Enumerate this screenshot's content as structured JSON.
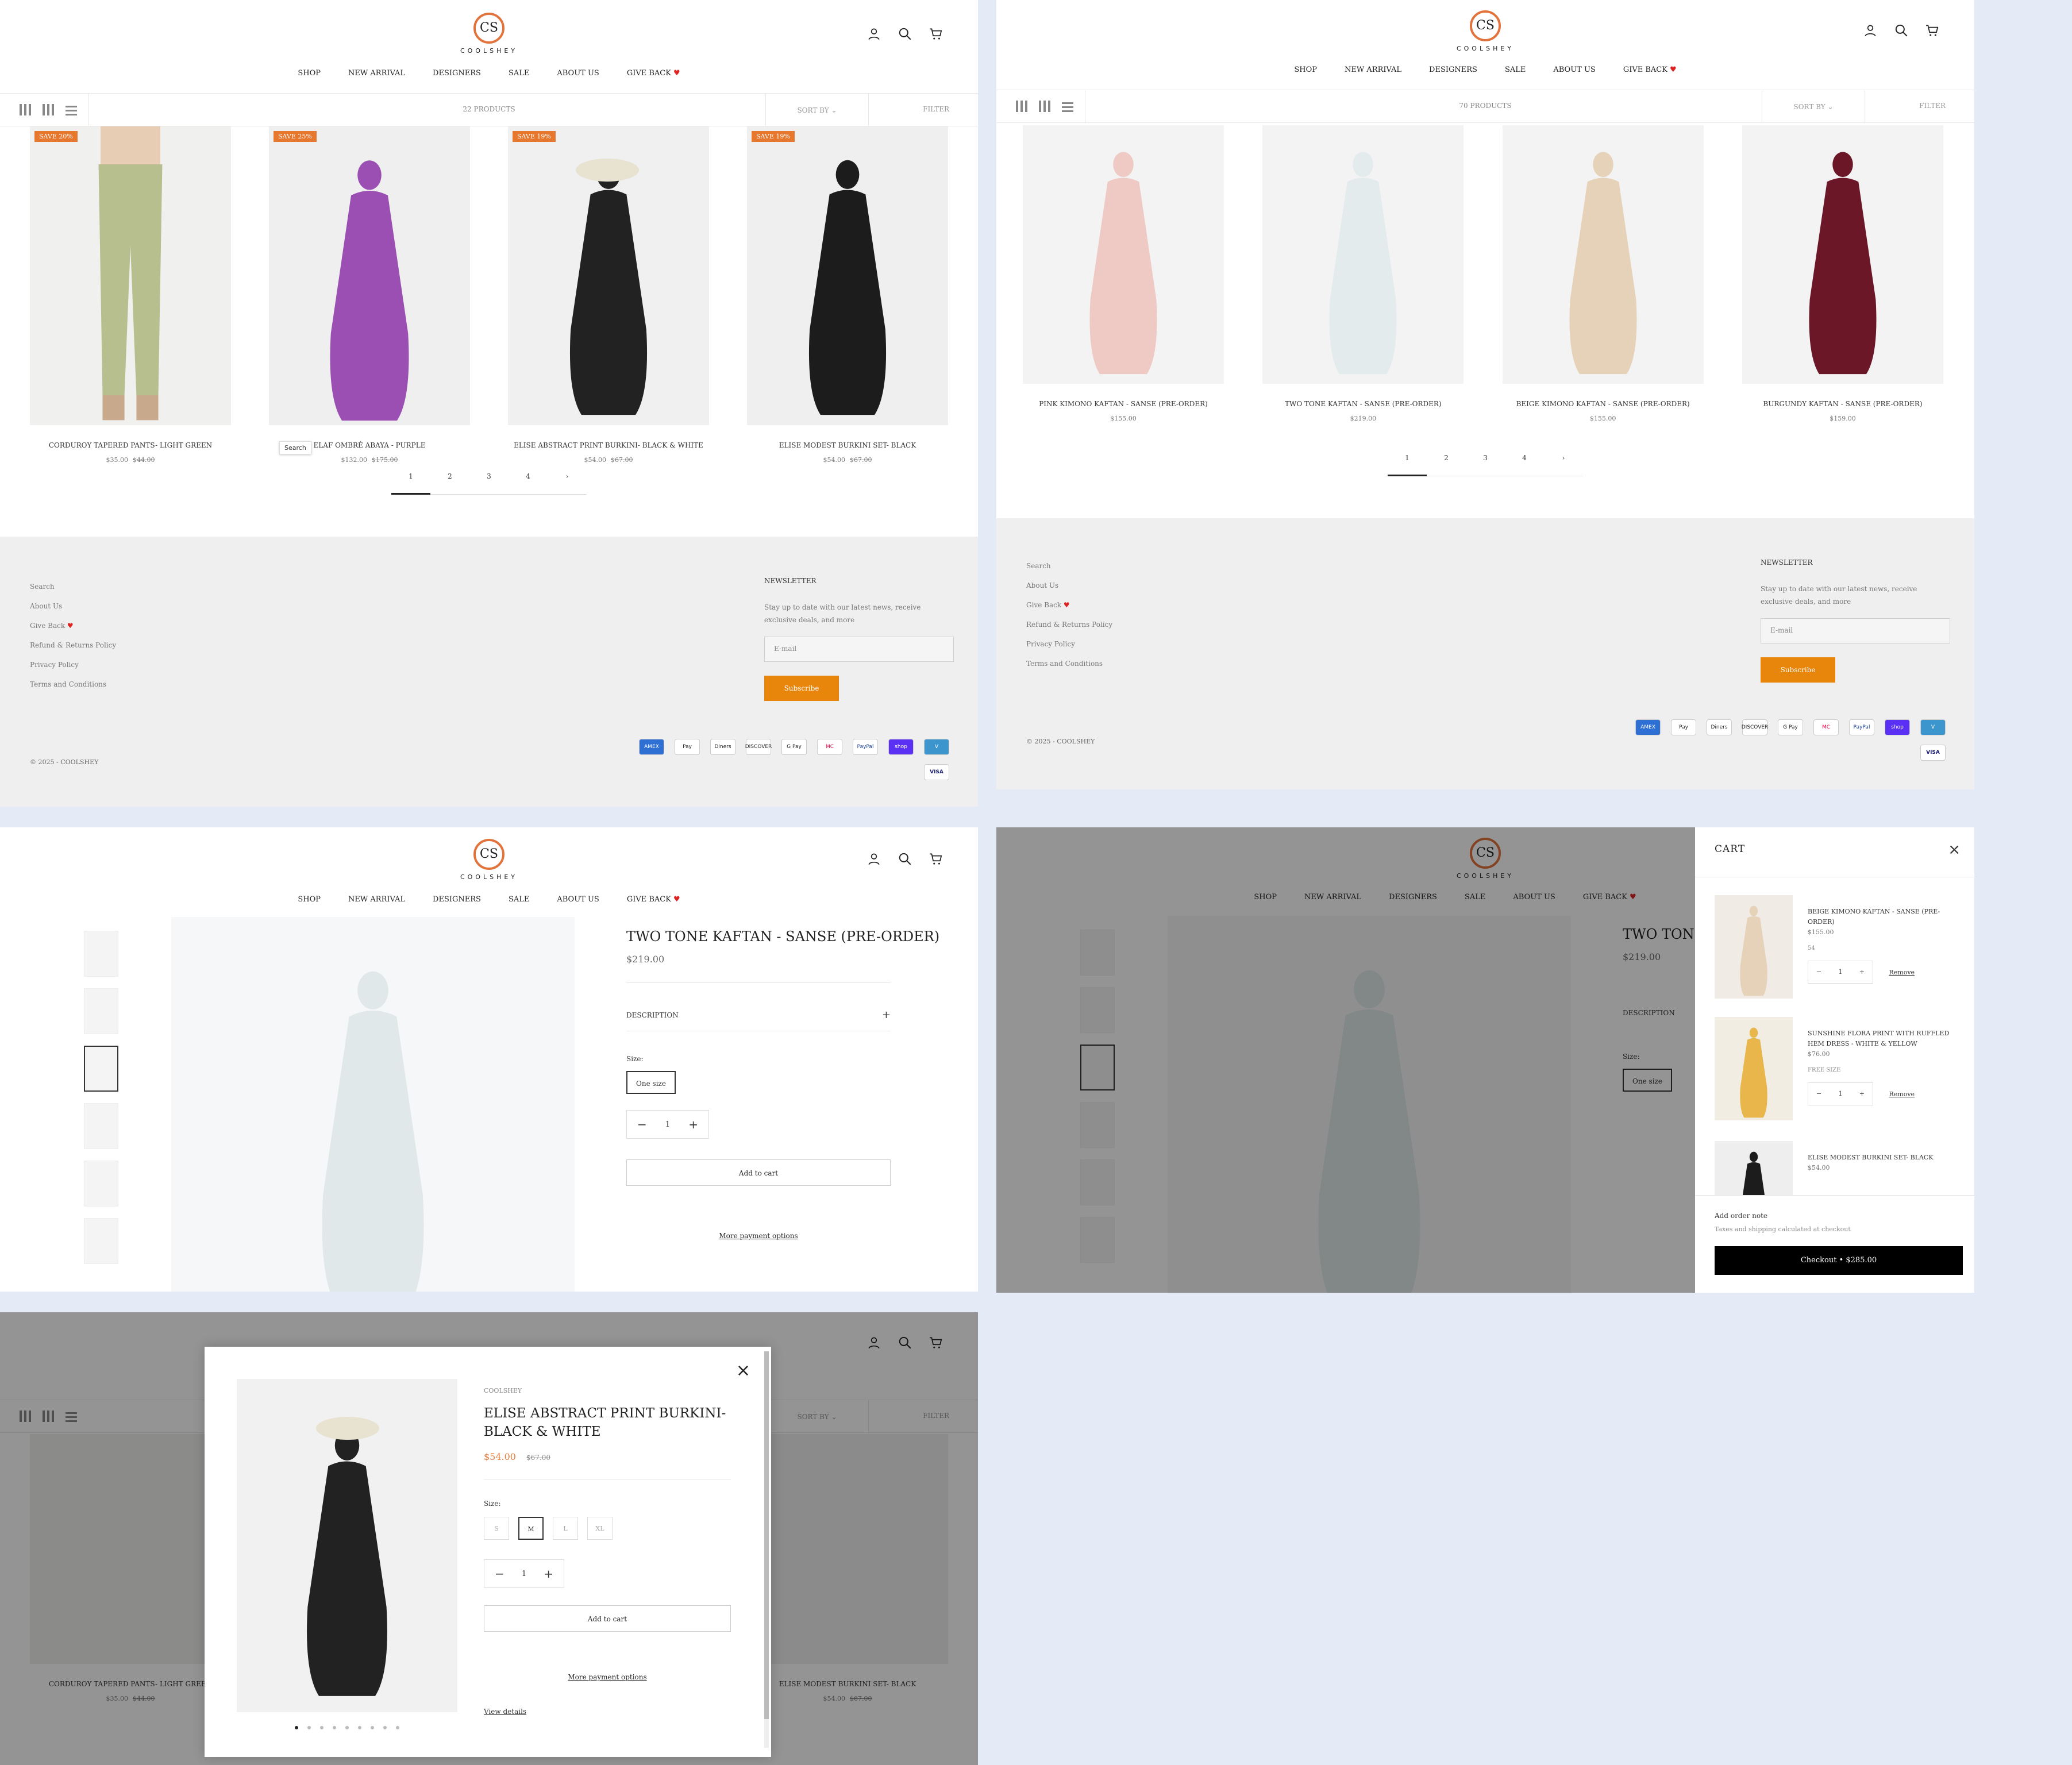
{
  "brand": {
    "name": "COOLSHEY",
    "mark": "CS"
  },
  "nav": [
    "SHOP",
    "NEW ARRIVAL",
    "DESIGNERS",
    "SALE",
    "ABOUT US",
    "GIVE BACK"
  ],
  "colors": {
    "accent": "#e8850b",
    "badge": "#e8772e",
    "heart": "#dd2222",
    "sale_price": "#e37b3b"
  },
  "listing1": {
    "count": "22 PRODUCTS",
    "sort": "SORT BY",
    "filter": "FILTER",
    "products": [
      {
        "badge": "SAVE 20%",
        "name": "CORDUROY TAPERED PANTS- LIGHT GREEN",
        "price": "$35.00",
        "compare": "$44.00"
      },
      {
        "badge": "SAVE 25%",
        "name": "ELAF OMBRÉ ABAYA - PURPLE",
        "price": "$132.00",
        "compare": "$175.00"
      },
      {
        "badge": "SAVE 19%",
        "name": "ELISE ABSTRACT PRINT BURKINI- BLACK & WHITE",
        "price": "$54.00",
        "compare": "$67.00"
      },
      {
        "badge": "SAVE 19%",
        "name": "ELISE MODEST BURKINI SET- BLACK",
        "price": "$54.00",
        "compare": "$67.00"
      }
    ],
    "tooltip": "Search",
    "pages": [
      "1",
      "2",
      "3",
      "4",
      "›"
    ]
  },
  "listing2": {
    "count": "70 PRODUCTS",
    "sort": "SORT BY",
    "filter": "FILTER",
    "products": [
      {
        "name": "PINK KIMONO KAFTAN - SANSE (PRE-ORDER)",
        "price": "$155.00"
      },
      {
        "name": "TWO TONE KAFTAN - SANSE (PRE-ORDER)",
        "price": "$219.00"
      },
      {
        "name": "BEIGE KIMONO KAFTAN - SANSE (PRE-ORDER)",
        "price": "$155.00"
      },
      {
        "name": "BURGUNDY KAFTAN - SANSE (PRE-ORDER)",
        "price": "$159.00"
      }
    ],
    "pages": [
      "1",
      "2",
      "3",
      "4",
      "›"
    ]
  },
  "footer": {
    "links": [
      "Search",
      "About Us",
      "Give Back",
      "Refund & Returns Policy",
      "Privacy Policy",
      "Terms and Conditions"
    ],
    "newsletter_title": "NEWSLETTER",
    "newsletter_text": "Stay up to date with our latest news, receive exclusive deals, and more",
    "email_placeholder": "E-mail",
    "subscribe": "Subscribe",
    "copyright": "© 2025 - COOLSHEY",
    "payments": [
      "AMEX",
      "Pay",
      "Diners",
      "DISCOVER",
      "G Pay",
      "MC",
      "PayPal",
      "shop",
      "V",
      "VISA"
    ]
  },
  "pdp": {
    "title": "TWO TONE KAFTAN - SANSE (PRE-ORDER)",
    "price": "$219.00",
    "description": "DESCRIPTION",
    "size_label": "Size:",
    "size": "One size",
    "qty": "1",
    "add_to_cart": "Add to cart",
    "more_payment": "More payment options",
    "title_partial": "TWO TONE"
  },
  "cart": {
    "title": "CART",
    "items": [
      {
        "name": "BEIGE KIMONO KAFTAN - SANSE (PRE-ORDER)",
        "price": "$155.00",
        "variant": "54",
        "qty": "1",
        "remove": "Remove"
      },
      {
        "name": "SUNSHINE FLORA PRINT WITH RUFFLED HEM DRESS - WHITE & YELLOW",
        "price": "$76.00",
        "variant": "FREE SIZE",
        "qty": "1",
        "remove": "Remove"
      },
      {
        "name": "ELISE MODEST BURKINI SET- BLACK",
        "price": "$54.00"
      }
    ],
    "order_note": "Add order note",
    "taxes": "Taxes and shipping calculated at checkout",
    "checkout": "Checkout",
    "total": "$285.00"
  },
  "quickview": {
    "vendor": "COOLSHEY",
    "title": "ELISE ABSTRACT PRINT BURKINI- BLACK & WHITE",
    "price": "$54.00",
    "compare": "$67.00",
    "size_label": "Size:",
    "sizes": [
      "S",
      "M",
      "L",
      "XL"
    ],
    "qty": "1",
    "add_to_cart": "Add to cart",
    "more_payment": "More payment options",
    "view_details": "View details",
    "sort": "SORT BY",
    "filter": "FILTER",
    "bg_products": [
      {
        "name": "CORDUROY TAPERED PANTS- LIGHT GREEN",
        "price": "$35.00",
        "compare": "$44.00"
      },
      {
        "name": "ELISE MODEST BURKINI SET- BLACK",
        "price": "$54.00",
        "compare": "$67.00"
      }
    ]
  }
}
